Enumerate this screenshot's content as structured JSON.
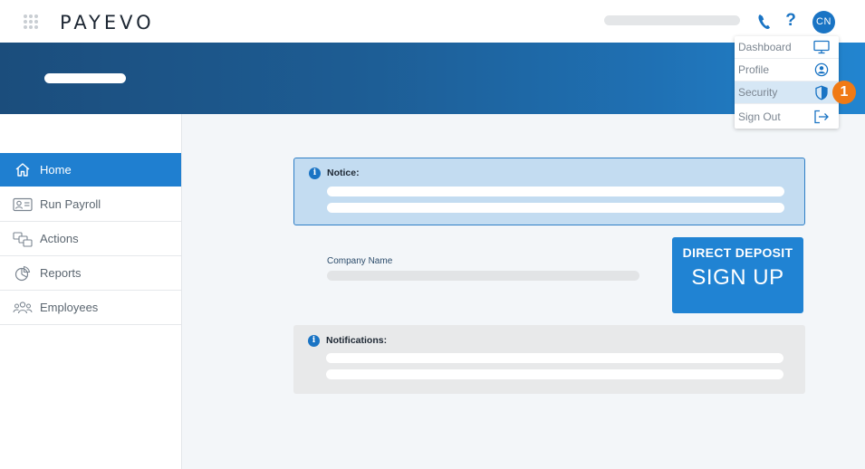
{
  "header": {
    "logo_text": "PAYEVO",
    "avatar_initials": "CN",
    "help_glyph": "?"
  },
  "sidebar": {
    "items": [
      {
        "label": "Home",
        "icon": "home-icon",
        "active": true
      },
      {
        "label": "Run Payroll",
        "icon": "payroll-icon",
        "active": false
      },
      {
        "label": "Actions",
        "icon": "actions-icon",
        "active": false
      },
      {
        "label": "Reports",
        "icon": "reports-icon",
        "active": false
      },
      {
        "label": "Employees",
        "icon": "employees-icon",
        "active": false
      }
    ]
  },
  "notice": {
    "title": "Notice:",
    "info_glyph": "i"
  },
  "company": {
    "label": "Company Name"
  },
  "direct_deposit": {
    "line1": "DIRECT DEPOSIT",
    "line2": "SIGN UP"
  },
  "notifications": {
    "title": "Notifications:",
    "info_glyph": "i"
  },
  "user_menu": {
    "items": [
      {
        "label": "Dashboard",
        "icon": "monitor-icon"
      },
      {
        "label": "Profile",
        "icon": "user-circle-icon"
      },
      {
        "label": "Security",
        "icon": "shield-icon",
        "active": true
      },
      {
        "label": "Sign Out",
        "icon": "sign-out-icon"
      }
    ]
  },
  "step_badge": "1",
  "colors": {
    "accent": "#1f7fd0",
    "badge": "#f07a15",
    "notice_bg": "#c3dcf1"
  }
}
